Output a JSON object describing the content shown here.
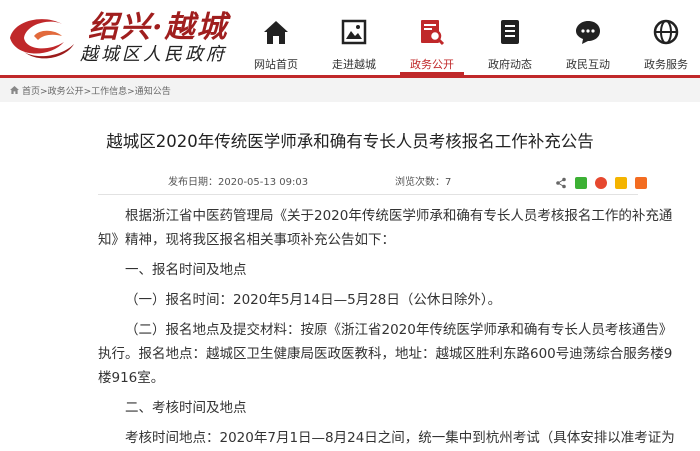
{
  "site": {
    "title": "绍兴·越城",
    "subtitle": "越城区人民政府"
  },
  "nav": {
    "items": [
      {
        "label": "网站首页",
        "icon": "home-icon"
      },
      {
        "label": "走进越城",
        "icon": "gallery-icon"
      },
      {
        "label": "政务公开",
        "icon": "search-document-icon"
      },
      {
        "label": "政府动态",
        "icon": "news-document-icon"
      },
      {
        "label": "政民互动",
        "icon": "chat-bubble-icon"
      },
      {
        "label": "政务服务",
        "icon": "service-globe-icon"
      }
    ],
    "active_index": 2
  },
  "breadcrumb": {
    "items": [
      "首页",
      "政务公开",
      "工作信息",
      "通知公告"
    ],
    "separator": ">"
  },
  "article": {
    "title": "越城区2020年传统医学师承和确有专长人员考核报名工作补充公告",
    "publish_label": "发布日期：",
    "publish_date": "2020-05-13 09:03",
    "views_label": "浏览次数：",
    "views": "7",
    "paragraphs": [
      "根据浙江省中医药管理局《关于2020年传统医学师承和确有专长人员考核报名工作的补充通知》精神，现将我区报名相关事项补充公告如下：",
      "一、报名时间及地点",
      "（一）报名时间：2020年5月14日—5月28日（公休日除外）。",
      "（二）报名地点及提交材料：按原《浙江省2020年传统医学师承和确有专长人员考核通告》执行。报名地点：越城区卫生健康局医政医教科，地址：越城区胜利东路600号迪荡综合服务楼9楼916室。",
      "二、考核时间及地点",
      "考核时间地点：2020年7月1日—8月24日之间，统一集中到杭州考试（具体安排以准考证为"
    ]
  },
  "share": {
    "icons": [
      "share-icon",
      "wechat-icon",
      "weibo-icon",
      "qzone-icon",
      "plus-icon"
    ]
  },
  "colors": {
    "accent": "#c0282a",
    "breadcrumb_bg": "#f3f3f3"
  }
}
